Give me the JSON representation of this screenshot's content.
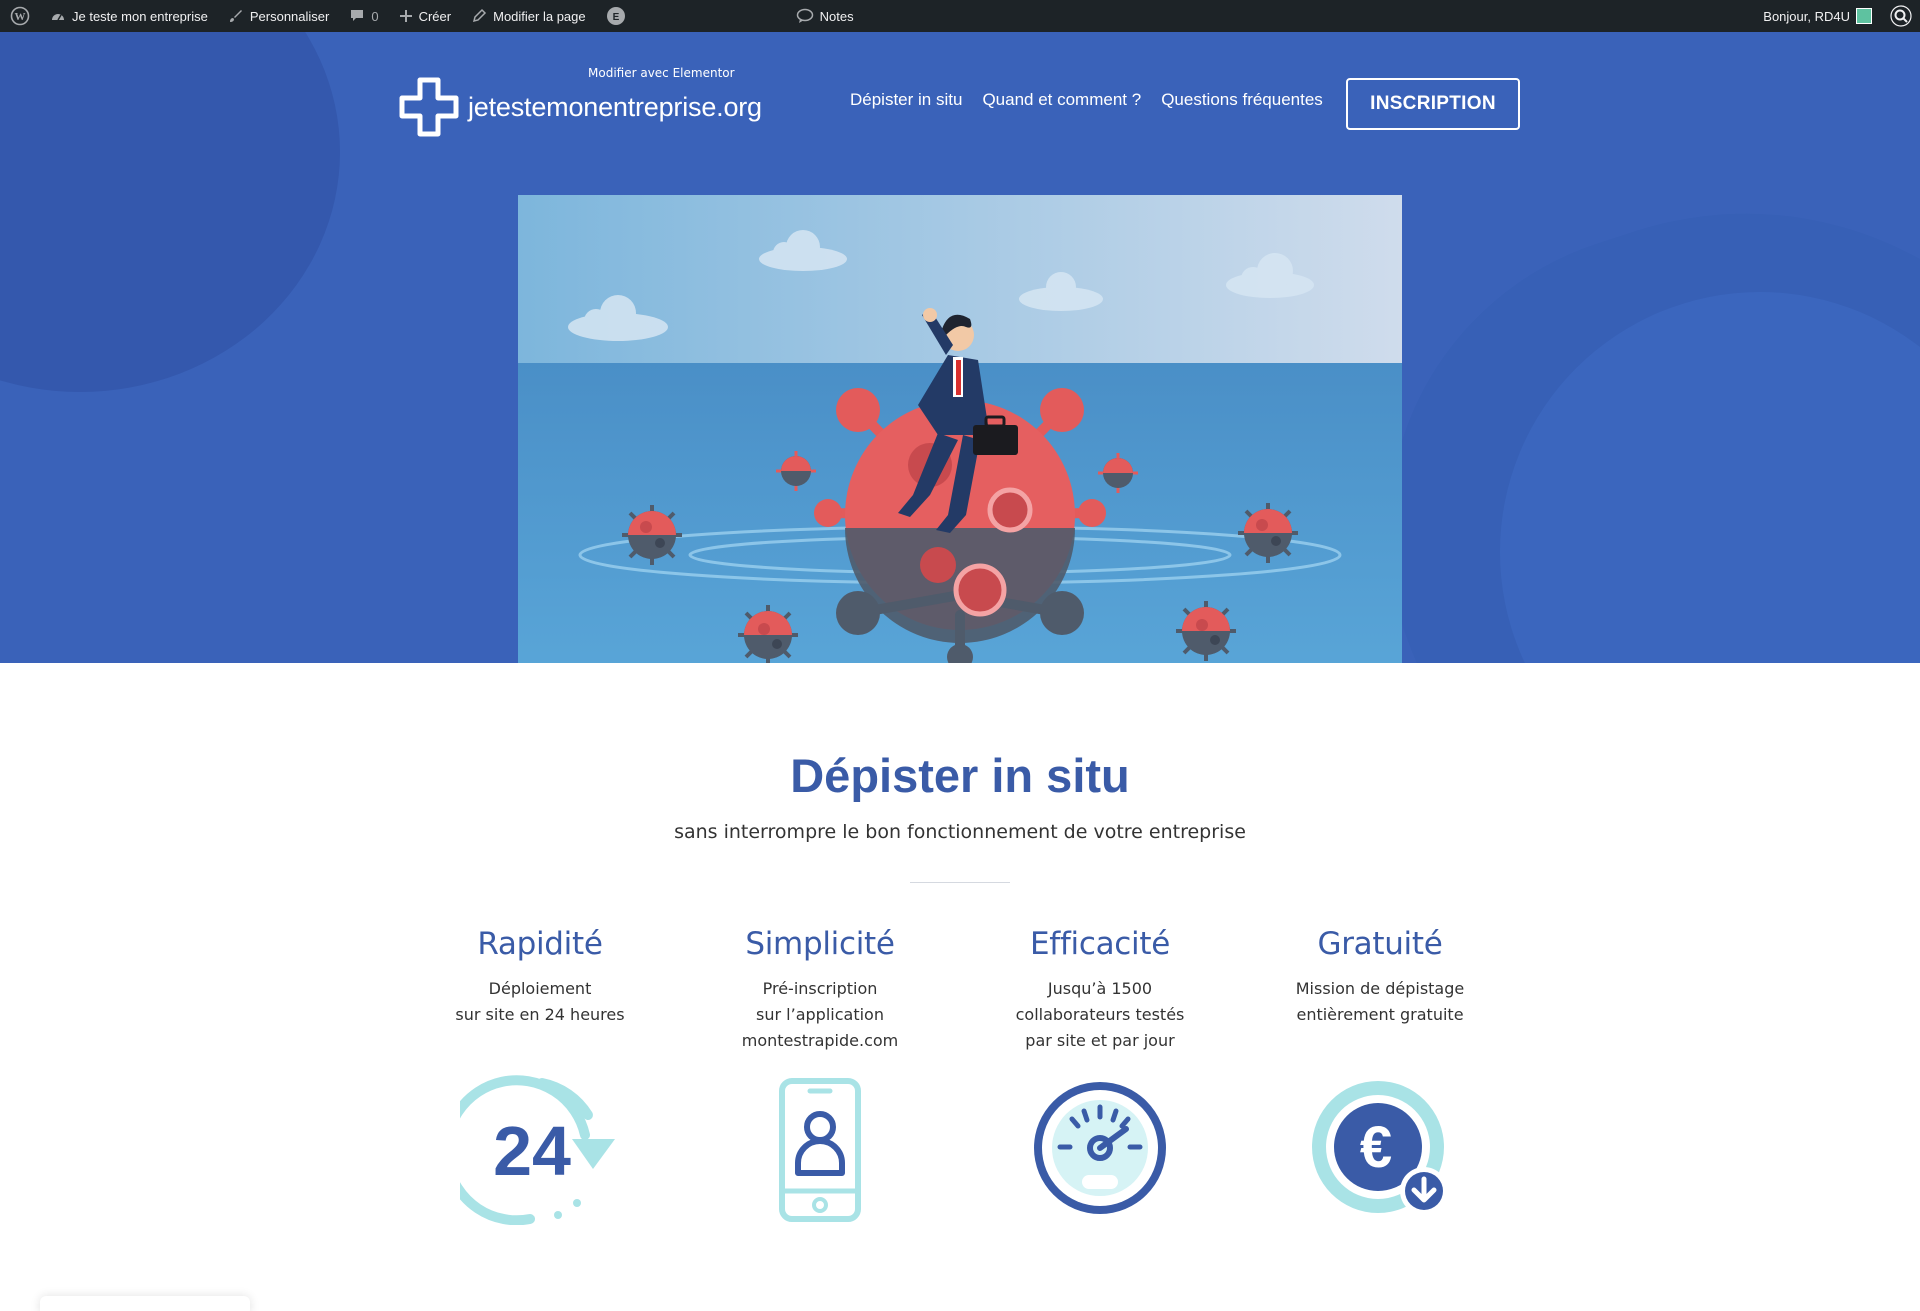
{
  "admin_bar": {
    "site_name": "Je teste mon entreprise",
    "customize": "Personnaliser",
    "comments_count": "0",
    "create": "Créer",
    "edit_page": "Modifier la page",
    "elementor_badge": "E",
    "notes": "Notes",
    "greeting": "Bonjour, RD4U"
  },
  "elementor_tooltip": "Modifier avec Elementor",
  "header": {
    "logo_text": "jetestemonentreprise.org",
    "nav": [
      "Dépister in situ",
      "Quand et comment ?",
      "Questions fréquentes"
    ],
    "cta": "INSCRIPTION"
  },
  "section": {
    "title": "Dépister in situ",
    "subtitle": "sans interrompre le bon fonctionnement de votre entreprise"
  },
  "features": [
    {
      "title": "Rapidité",
      "lines": [
        "Déploiement",
        "sur site en 24 heures"
      ],
      "icon": "clock-24-icon",
      "icon_text": "24"
    },
    {
      "title": "Simplicité",
      "lines": [
        "Pré-inscription",
        "sur l’application",
        "montestrapide.com"
      ],
      "icon": "smartphone-user-icon"
    },
    {
      "title": "Efficacité",
      "lines": [
        "Jusqu’à 1500",
        "collaborateurs testés",
        "par site et par jour"
      ],
      "icon": "speedometer-icon"
    },
    {
      "title": "Gratuité",
      "lines": [
        "Mission de dépistage",
        "entièrement gratuite"
      ],
      "icon": "euro-coin-icon",
      "icon_text": "€"
    }
  ],
  "colors": {
    "admin_bar": "#1d2327",
    "hero_blue": "#3a62b9",
    "heading_blue": "#3a5ba7",
    "icon_teal": "#a9e3e6",
    "icon_dark_blue": "#3a5ba7"
  }
}
